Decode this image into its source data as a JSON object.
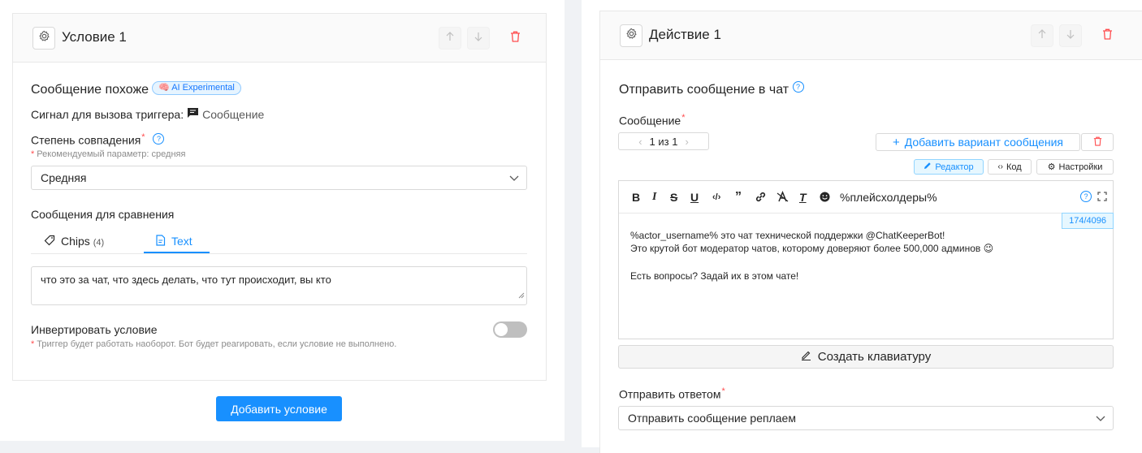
{
  "condition": {
    "title": "Условие 1",
    "type_label": "Сообщение похоже",
    "ai_badge": "🧠 AI Experimental",
    "signal_label": "Сигнал для вызова триггера:",
    "signal_value": "Сообщение",
    "match_label": "Степень совпадения",
    "match_hint": "Рекомендуемый параметр: средняя",
    "match_value": "Средняя",
    "compare_label": "Сообщения для сравнения",
    "tabs": [
      {
        "label": "Chips",
        "count": "(4)"
      },
      {
        "label": "Text"
      }
    ],
    "compare_text": "что это за чат, что здесь делать, что тут происходит, вы кто",
    "invert_label": "Инвертировать условие",
    "invert_hint": "Триггер будет работать наоборот. Бот будет реагировать, если условие не выполнено.",
    "invert_enabled": false,
    "add_button": "Добавить условие"
  },
  "action": {
    "title": "Действие 1",
    "type_label": "Отправить сообщение в чат",
    "message_label": "Сообщение",
    "pager": "1 из 1",
    "add_variant": "Добавить вариант сообщения",
    "mode_editor": "Редактор",
    "mode_code": "Код",
    "mode_settings": "Настройки",
    "placeholders": "%плейсхолдеры%",
    "counter": "174/4096",
    "message_lines": [
      "%actor_username% это чат технической поддержки @ChatKeeperBot!",
      "Это крутой бот модератор чатов, которому доверяют более 500,000 админов 😉",
      "",
      "Есть вопросы? Задай их в этом чате!"
    ],
    "keyboard_button": "Создать клавиатуру",
    "reply_label": "Отправить ответом",
    "reply_value": "Отправить сообщение реплаем"
  },
  "colors": {
    "primary": "#1890ff",
    "danger": "#ff4d4f",
    "border": "#d9d9d9"
  }
}
